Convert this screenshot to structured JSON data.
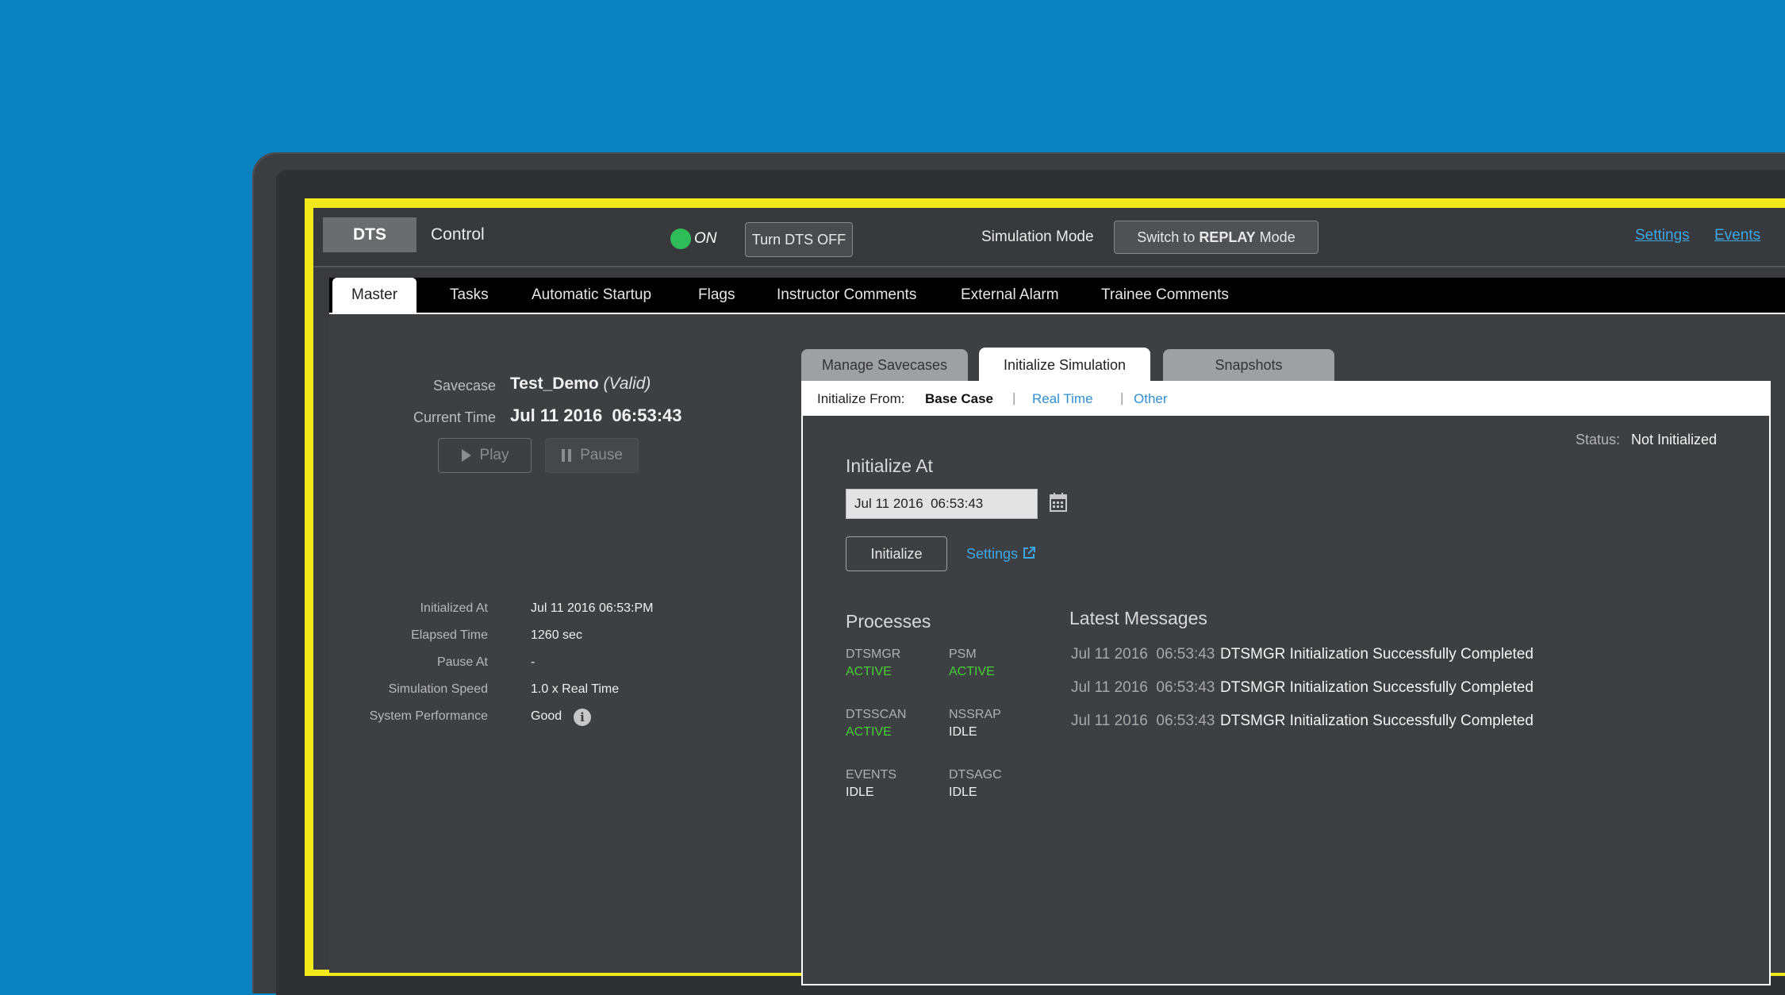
{
  "topbar": {
    "badge": "DTS",
    "title": "Control",
    "power_state": "ON",
    "turn_off_label": "Turn DTS OFF",
    "sim_mode_label": "Simulation Mode",
    "switch_prefix": "Switch to",
    "switch_bold": "REPLAY",
    "switch_suffix": "Mode",
    "settings_link": "Settings",
    "events_link": "Events",
    "status_color": "#2ebd59"
  },
  "tabs": [
    "Master",
    "Tasks",
    "Automatic Startup",
    "Flags",
    "Instructor Comments",
    "External Alarm",
    "Trainee Comments"
  ],
  "left": {
    "savecase_label": "Savecase",
    "savecase_value": "Test_Demo",
    "savecase_valid": "(Valid)",
    "current_time_label": "Current Time",
    "current_time_value": "Jul 11 2016  06:53:43",
    "play_label": "Play",
    "pause_label": "Pause",
    "info": [
      {
        "label": "Initialized At",
        "value": "Jul 11 2016 06:53:PM"
      },
      {
        "label": "Elapsed Time",
        "value": "1260 sec"
      },
      {
        "label": "Pause At",
        "value": "-"
      },
      {
        "label": "Simulation Speed",
        "value": "1.0 x Real Time"
      },
      {
        "label": "System Performance",
        "value": "Good"
      }
    ]
  },
  "subtabs": [
    "Manage Savecases",
    "Initialize Simulation",
    "Snapshots"
  ],
  "init_from": {
    "label": "Initialize From:",
    "options": [
      "Base Case",
      "Real Time",
      "Other"
    ],
    "separator": "|"
  },
  "status": {
    "label": "Status:",
    "value": "Not Initialized"
  },
  "init_at": {
    "title": "Initialize At",
    "date_value": "Jul 11 2016  06:53:43",
    "button": "Initialize",
    "settings_link": "Settings"
  },
  "processes": {
    "title": "Processes",
    "items": [
      {
        "name": "DTSMGR",
        "status": "ACTIVE"
      },
      {
        "name": "PSM",
        "status": "ACTIVE"
      },
      {
        "name": "DTSSCAN",
        "status": "ACTIVE"
      },
      {
        "name": "NSSRAP",
        "status": "IDLE"
      },
      {
        "name": "EVENTS",
        "status": "IDLE"
      },
      {
        "name": "DTSAGC",
        "status": "IDLE"
      }
    ],
    "active_color": "#46d035",
    "idle_color": "#f2f2f2"
  },
  "messages": {
    "title": "Latest Messages",
    "items": [
      {
        "time": "Jul 11 2016  06:53:43",
        "text": "DTSMGR Initialization Successfully Completed"
      },
      {
        "time": "Jul 11 2016  06:53:43",
        "text": "DTSMGR Initialization Successfully Completed"
      },
      {
        "time": "Jul 11 2016  06:53:43",
        "text": "DTSMGR Initialization Successfully Completed"
      }
    ]
  },
  "colors": {
    "accent": "#3ca6e6",
    "highlight": "#f2ea18",
    "background": "#0a82c0"
  }
}
